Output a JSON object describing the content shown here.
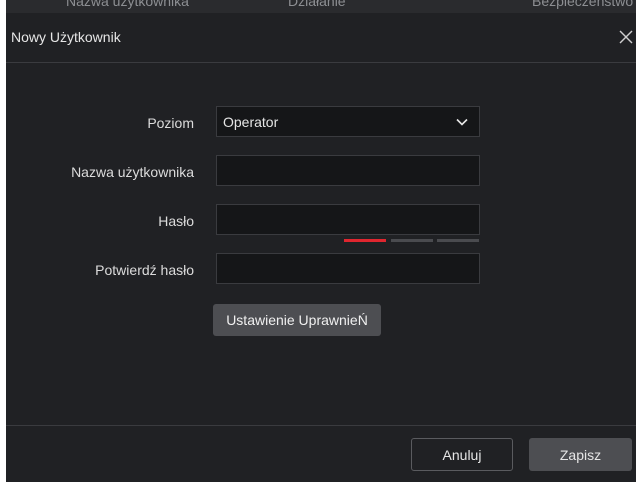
{
  "background_table": {
    "columns": [
      "Nazwa użytkownika",
      "Działanie",
      "Bezpieczeństwo"
    ]
  },
  "dialog": {
    "title": "Nowy Użytkownik",
    "close_icon": "close-icon"
  },
  "form": {
    "level_label": "Poziom",
    "level_value": "Operator",
    "username_label": "Nazwa użytkownika",
    "username_value": "",
    "password_label": "Hasło",
    "password_value": "",
    "password_strength": {
      "level": 1,
      "max": 3
    },
    "confirm_label": "Potwierdź hasło",
    "confirm_value": "",
    "permissions_button": "Ustawienie UprawnieŃ"
  },
  "footer": {
    "cancel": "Anuluj",
    "save": "Zapisz"
  },
  "colors": {
    "dialog_bg": "#202124",
    "field_bg": "#151618",
    "strength_weak": "#e0262f",
    "strength_empty": "#4a4b4f"
  }
}
